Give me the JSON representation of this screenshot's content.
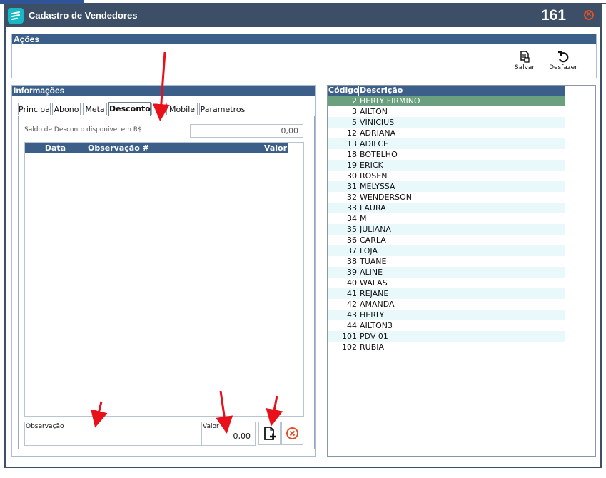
{
  "window": {
    "title": "Cadastro de Vendedores",
    "code": "161",
    "close_icon": "close-circle-icon"
  },
  "acoes": {
    "header": "Ações",
    "salvar_label": "Salvar",
    "desfazer_label": "Desfazer"
  },
  "informacoes": {
    "header": "Informações",
    "tabs": [
      "Principal",
      "Abono",
      "Meta",
      "Desconto",
      "",
      "Mobile",
      "Parametros"
    ],
    "active_tab": "Desconto"
  },
  "desconto": {
    "saldo_label": "Saldo de Desconto disponivel em R$",
    "saldo_value": "0,00",
    "columns": [
      "Data",
      "Observação #",
      "Valor"
    ],
    "obs_label": "Observação",
    "valor_label": "Valor",
    "valor_value": "0,00"
  },
  "vendedores": {
    "columns": [
      "Código",
      "Descrição"
    ],
    "rows": [
      {
        "codigo": "2",
        "descricao": "HERLY  FIRMINO"
      },
      {
        "codigo": "3",
        "descricao": "AILTON"
      },
      {
        "codigo": "5",
        "descricao": "VINICIUS"
      },
      {
        "codigo": "12",
        "descricao": "ADRIANA"
      },
      {
        "codigo": "13",
        "descricao": "ADILCE"
      },
      {
        "codigo": "18",
        "descricao": "BOTELHO"
      },
      {
        "codigo": "19",
        "descricao": "ERICK"
      },
      {
        "codigo": "30",
        "descricao": "ROSEN"
      },
      {
        "codigo": "31",
        "descricao": "MELYSSA"
      },
      {
        "codigo": "32",
        "descricao": "WENDERSON"
      },
      {
        "codigo": "33",
        "descricao": "LAURA"
      },
      {
        "codigo": "34",
        "descricao": "M"
      },
      {
        "codigo": "35",
        "descricao": "JULIANA"
      },
      {
        "codigo": "36",
        "descricao": "CARLA"
      },
      {
        "codigo": "37",
        "descricao": "LOJA"
      },
      {
        "codigo": "38",
        "descricao": "TUANE"
      },
      {
        "codigo": "39",
        "descricao": "ALINE"
      },
      {
        "codigo": "40",
        "descricao": "WALAS"
      },
      {
        "codigo": "41",
        "descricao": "REJANE"
      },
      {
        "codigo": "42",
        "descricao": "AMANDA"
      },
      {
        "codigo": "43",
        "descricao": "HERLY"
      },
      {
        "codigo": "44",
        "descricao": "AILTON3"
      },
      {
        "codigo": "101",
        "descricao": "PDV 01"
      },
      {
        "codigo": "102",
        "descricao": "RUBIA"
      }
    ],
    "selected_index": 0
  },
  "colors": {
    "titlebar": "#3c4f66",
    "header": "#3c5f89",
    "selected_row": "#6aa07e",
    "annotation_arrow": "#e8101a"
  }
}
